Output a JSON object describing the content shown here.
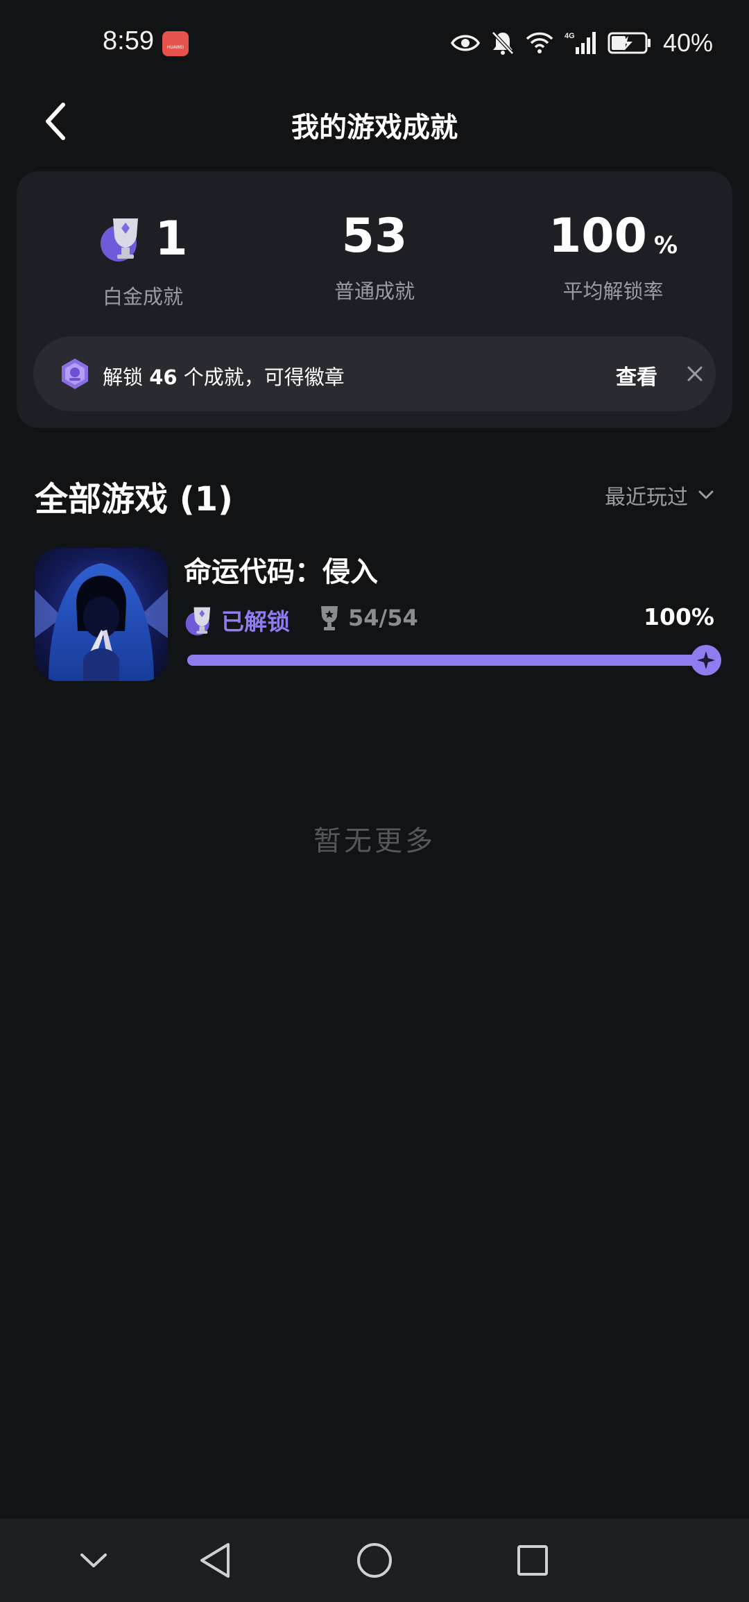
{
  "status_bar": {
    "time": "8:59",
    "app_badge": "HUAWEI",
    "battery": "40%",
    "network": "4G"
  },
  "header": {
    "title": "我的游戏成就"
  },
  "summary": {
    "platinum": {
      "value": "1",
      "label": "白金成就"
    },
    "normal": {
      "value": "53",
      "label": "普通成就"
    },
    "rate": {
      "value": "100",
      "unit": "%",
      "label": "平均解锁率"
    }
  },
  "banner": {
    "prefix": "解锁 ",
    "count": "46",
    "suffix": " 个成就，可得徽章",
    "view_label": "查看"
  },
  "games_section": {
    "title": "全部游戏 (1)",
    "sort_label": "最近玩过"
  },
  "games": [
    {
      "name": "命运代码：侵入",
      "status": "已解锁",
      "achievements": "54/54",
      "percent": "100%",
      "progress": 1.0
    }
  ],
  "empty_text": "暂无更多",
  "colors": {
    "background": "#111314",
    "card": "#1e1f24",
    "accent": "#8f7df0",
    "muted": "#9a9ca3"
  }
}
